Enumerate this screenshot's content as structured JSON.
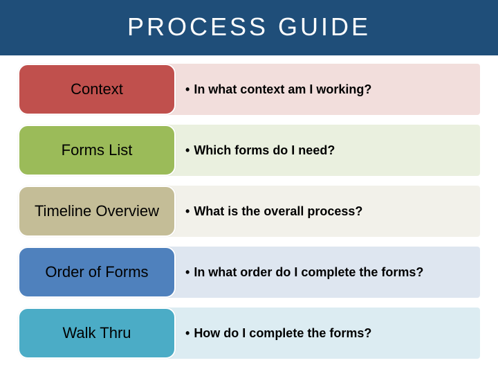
{
  "header": {
    "title": "PROCESS GUIDE"
  },
  "rows": [
    {
      "label": "Context",
      "question": "In what context am I working?"
    },
    {
      "label": "Forms List",
      "question": "Which forms do I need?"
    },
    {
      "label": "Timeline Overview",
      "question": "What is the overall process?"
    },
    {
      "label": "Order of Forms",
      "question": "In what order do I complete the forms?"
    },
    {
      "label": "Walk Thru",
      "question": "How do I complete the forms?"
    }
  ],
  "colors": {
    "header_bg": "#1f4e79",
    "row_colors": [
      "#c0504d",
      "#9bbb59",
      "#c4bd97",
      "#4f81bd",
      "#4bacc6"
    ]
  }
}
